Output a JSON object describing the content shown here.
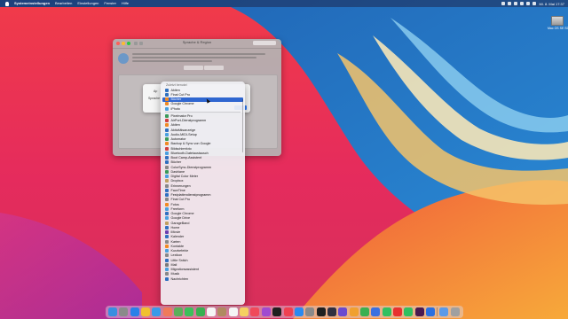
{
  "menubar": {
    "app_name": "Systemeinstellungen",
    "items": [
      "Bearbeiten",
      "Einstellungen",
      "Fenster",
      "Hilfe"
    ],
    "clock": "Mi. 8. Mai 17:37"
  },
  "desktop": {
    "drive_label": "Mac OS SE SD"
  },
  "pref_window": {
    "title": "Sprache & Region"
  },
  "sheet": {
    "app_label": "Ap",
    "lang_label": "Sprache"
  },
  "app_list": {
    "header": "Zuletzt benutzt",
    "recent": [
      "Aktien",
      "Final Cut Pro",
      "Bücher",
      "Google Chrome",
      "iPhoto"
    ],
    "items": [
      "Pixelmator Pro",
      "AirPort-Dienstprogramm",
      "Aktien",
      "Aktivitätsanzeige",
      "Audio-MIDI-Setup",
      "Automator",
      "Backup & Sync von Google",
      "Bildschirmfoto",
      "Bluetooth-Dateiaustausch",
      "Boot Camp-Assistent",
      "Bücher",
      "ColorSync-Dienstprogramm",
      "Dashlane",
      "Digital Color Meter",
      "Dropbox",
      "Erinnerungen",
      "FaceTime",
      "Festplattendienstprogramm",
      "Final Cut Pro",
      "Fotos",
      "Freeform",
      "Google Chrome",
      "Google Drive",
      "GarageBand",
      "Home",
      "iMovie",
      "Kalender",
      "Karten",
      "Kontakte",
      "Kurzbefehle",
      "Lexikon",
      "Little Snitch",
      "Mail",
      "Migrationsassistent",
      "Musik",
      "Nachrichten"
    ],
    "selected": "Bücher"
  },
  "colors": {
    "accent": "#2f66d0",
    "menubar": "#1e2850"
  },
  "dock": {
    "icons": [
      "finder-icon",
      "launchpad-icon",
      "safari-icon",
      "chrome-icon",
      "mail-icon",
      "photos-icon",
      "maps-icon",
      "messages-icon",
      "facetime-icon",
      "calendar-icon",
      "contacts-icon",
      "reminders-icon",
      "notes-icon",
      "music-icon",
      "podcasts-icon",
      "tv-icon",
      "news-icon",
      "appstore-icon",
      "settings-icon",
      "terminal-icon",
      "finalcut-icon",
      "imovie-icon",
      "pages-icon",
      "numbers-icon",
      "keynote-icon",
      "whatsapp-icon",
      "youtube-icon",
      "spotify-icon",
      "slack-icon",
      "dropbox-icon",
      "downloads-icon",
      "trash-icon"
    ]
  }
}
